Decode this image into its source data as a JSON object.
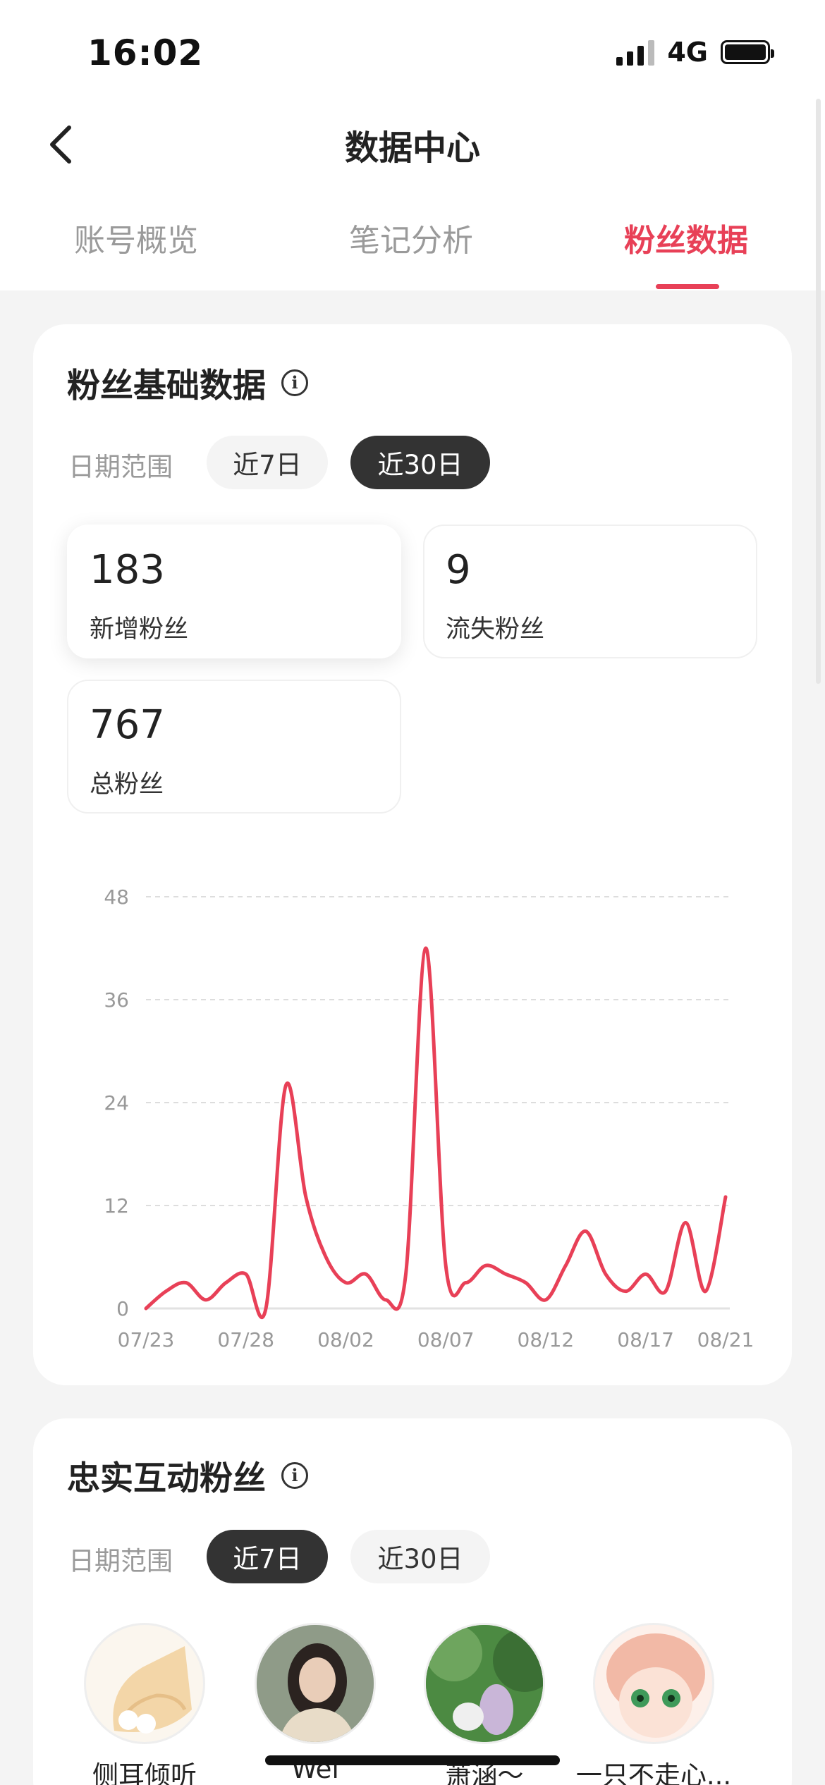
{
  "status_bar": {
    "time": "16:02",
    "network": "4G",
    "icons": [
      "signal-icon",
      "battery-icon"
    ]
  },
  "header": {
    "title": "数据中心",
    "back_icon": "chevron-left-icon"
  },
  "tabs": [
    {
      "label": "账号概览",
      "active": false
    },
    {
      "label": "笔记分析",
      "active": false
    },
    {
      "label": "粉丝数据",
      "active": true
    }
  ],
  "accent_color": "#e84057",
  "fan_basic": {
    "title": "粉丝基础数据",
    "date_range_label": "日期范围",
    "ranges": [
      {
        "label": "近7日",
        "selected": false
      },
      {
        "label": "近30日",
        "selected": true
      }
    ],
    "stats": [
      {
        "value": "183",
        "label": "新增粉丝",
        "selected": true
      },
      {
        "value": "9",
        "label": "流失粉丝",
        "selected": false
      },
      {
        "value": "767",
        "label": "总粉丝",
        "selected": false
      }
    ]
  },
  "chart_data": {
    "type": "line",
    "title": "",
    "xlabel": "",
    "ylabel": "",
    "x_ticks": [
      "07/23",
      "07/28",
      "08/02",
      "08/07",
      "08/12",
      "08/17",
      "08/21"
    ],
    "y_ticks": [
      0,
      12,
      24,
      36,
      48
    ],
    "ylim": [
      0,
      48
    ],
    "grid": true,
    "line_color": "#e84057",
    "series": [
      {
        "name": "",
        "x": [
          "07/23",
          "07/24",
          "07/25",
          "07/26",
          "07/27",
          "07/28",
          "07/29",
          "07/30",
          "07/31",
          "08/01",
          "08/02",
          "08/03",
          "08/04",
          "08/05",
          "08/06",
          "08/07",
          "08/08",
          "08/09",
          "08/10",
          "08/11",
          "08/12",
          "08/13",
          "08/14",
          "08/15",
          "08/16",
          "08/17",
          "08/18",
          "08/19",
          "08/20",
          "08/21"
        ],
        "values": [
          0,
          2,
          3,
          1,
          3,
          4,
          0,
          26,
          13,
          6,
          3,
          4,
          1,
          4,
          42,
          5,
          3,
          5,
          4,
          3,
          1,
          5,
          9,
          4,
          2,
          4,
          2,
          10,
          2,
          13
        ]
      }
    ]
  },
  "loyal_fans": {
    "title": "忠实互动粉丝",
    "date_range_label": "日期范围",
    "ranges": [
      {
        "label": "近7日",
        "selected": true
      },
      {
        "label": "近30日",
        "selected": false
      }
    ],
    "fans": [
      {
        "name": "侧耳倾听"
      },
      {
        "name": "Wei"
      },
      {
        "name": "萧涵～"
      },
      {
        "name": "一只不走心..."
      }
    ]
  }
}
